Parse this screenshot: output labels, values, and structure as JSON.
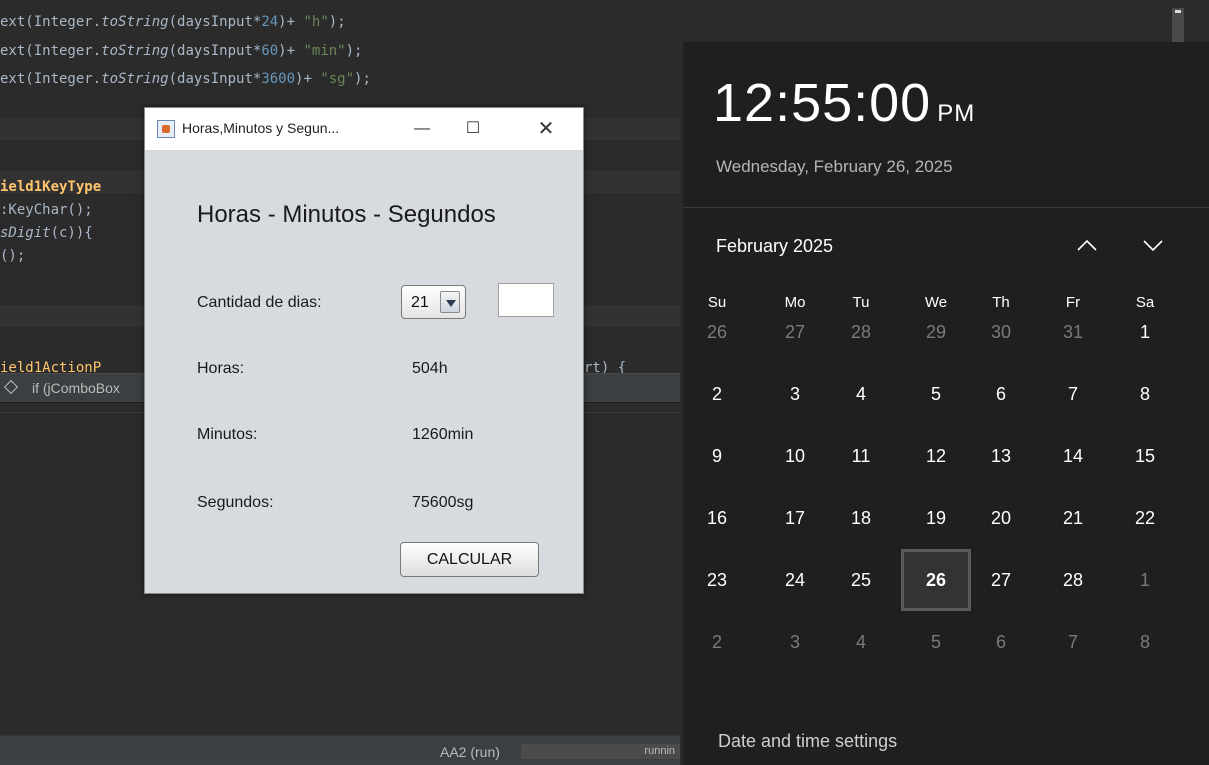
{
  "ide": {
    "code_lines": [
      {
        "a": "ext(Integer.",
        "b": "toString",
        "c": "(daysInput*",
        "d": "24",
        "e": ")+ ",
        "f": "\"h\"",
        "g": ");"
      },
      {
        "a": "ext(Integer.",
        "b": "toString",
        "c": "(daysInput*",
        "d": "60",
        "e": ")+ ",
        "f": "\"min\"",
        "g": ");"
      },
      {
        "a": "ext(Integer.",
        "b": "toString",
        "c": "(daysInput*",
        "d": "3600",
        "e": ")+ ",
        "f": "\"sg\"",
        "g": ");"
      }
    ],
    "snippet_keytyped": "ield1KeyType",
    "snippet_getkeychar": ":KeyChar();",
    "snippet_isdigit_a": "sDigit",
    "snippet_isdigit_b": "(c)){",
    "snippet_consume": "();",
    "snippet_action": "ield1ActionP",
    "snippet_action_tail": "rt) {",
    "breadcrumb": "if (jComboBox",
    "run_label": "AA2 (run)",
    "running_label": "runnin"
  },
  "swing_window": {
    "title": "Horas,Minutos y Segun...",
    "heading": "Horas - Minutos -  Segundos",
    "dias_label": "Cantidad de dias:",
    "dias_value": "21",
    "horas_label": "Horas:",
    "horas_value": "504h",
    "minutos_label": "Minutos:",
    "minutos_value": "1260min",
    "segundos_label": "Segundos:",
    "segundos_value": "75600sg",
    "calc_button": "CALCULAR",
    "minimize_glyph": "—",
    "maximize_glyph": "☐",
    "close_glyph": "✕"
  },
  "flyout": {
    "time": "12:55:00",
    "ampm": "PM",
    "date_full": "Wednesday, February 26, 2025",
    "month_label": "February 2025",
    "weekdays": [
      "Su",
      "Mo",
      "Tu",
      "We",
      "Th",
      "Fr",
      "Sa"
    ],
    "weeks": [
      [
        {
          "d": "26",
          "dim": true
        },
        {
          "d": "27",
          "dim": true
        },
        {
          "d": "28",
          "dim": true
        },
        {
          "d": "29",
          "dim": true
        },
        {
          "d": "30",
          "dim": true
        },
        {
          "d": "31",
          "dim": true
        },
        {
          "d": "1",
          "dim": false
        }
      ],
      [
        {
          "d": "2",
          "dim": false
        },
        {
          "d": "3",
          "dim": false
        },
        {
          "d": "4",
          "dim": false
        },
        {
          "d": "5",
          "dim": false
        },
        {
          "d": "6",
          "dim": false
        },
        {
          "d": "7",
          "dim": false
        },
        {
          "d": "8",
          "dim": false
        }
      ],
      [
        {
          "d": "9",
          "dim": false
        },
        {
          "d": "10",
          "dim": false
        },
        {
          "d": "11",
          "dim": false
        },
        {
          "d": "12",
          "dim": false
        },
        {
          "d": "13",
          "dim": false
        },
        {
          "d": "14",
          "dim": false
        },
        {
          "d": "15",
          "dim": false
        }
      ],
      [
        {
          "d": "16",
          "dim": false
        },
        {
          "d": "17",
          "dim": false
        },
        {
          "d": "18",
          "dim": false
        },
        {
          "d": "19",
          "dim": false
        },
        {
          "d": "20",
          "dim": false
        },
        {
          "d": "21",
          "dim": false
        },
        {
          "d": "22",
          "dim": false
        }
      ],
      [
        {
          "d": "23",
          "dim": false
        },
        {
          "d": "24",
          "dim": false
        },
        {
          "d": "25",
          "dim": false
        },
        {
          "d": "26",
          "dim": false,
          "today": true
        },
        {
          "d": "27",
          "dim": false
        },
        {
          "d": "28",
          "dim": false
        },
        {
          "d": "1",
          "dim": true
        }
      ],
      [
        {
          "d": "2",
          "dim": true
        },
        {
          "d": "3",
          "dim": true
        },
        {
          "d": "4",
          "dim": true
        },
        {
          "d": "5",
          "dim": true
        },
        {
          "d": "6",
          "dim": true
        },
        {
          "d": "7",
          "dim": true
        },
        {
          "d": "8",
          "dim": true
        }
      ]
    ],
    "settings_link": "Date and time settings",
    "icons": {
      "prev": "chevron-up-icon",
      "next": "chevron-down-icon"
    }
  }
}
